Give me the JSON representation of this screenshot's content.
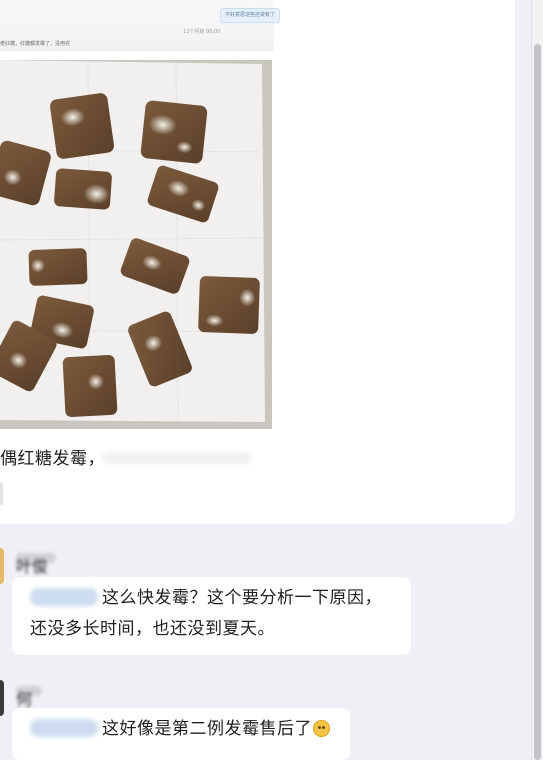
{
  "post": {
    "embedded": {
      "pill_text": "不好意思这些还说有了",
      "date_text": "12个月前 00:00",
      "body_text": "老红糖，红糖都发霉了，没用完"
    },
    "caption": "偶红糖发霉，",
    "photo": {
      "alt": "mold-covered brown sugar cubes on white paper towel",
      "colors": {
        "paper": "#f1f0ee",
        "cube": "#6b4c33",
        "mold": "#e6e4d8"
      }
    }
  },
  "comments": [
    {
      "nick": "叶俊",
      "mention": "@用户",
      "text_line1": "这么快发霉？这个要分析一下原因，",
      "text_line2": "还没多长时间，也还没到夏天。",
      "avatar_color": "#e6b86a"
    },
    {
      "nick": "何",
      "mention": "@用户",
      "text_line1": "这好像是第二例发霉售后了",
      "emoji": "crying-face",
      "avatar_color": "#3a3a3a"
    }
  ],
  "colors": {
    "background": "#eef0f5",
    "card": "#ffffff",
    "mention": "#cddcf0"
  }
}
